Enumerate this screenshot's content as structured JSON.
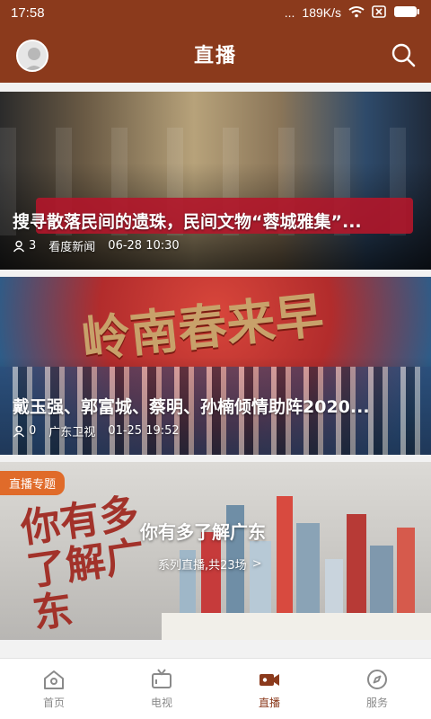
{
  "status_bar": {
    "time": "17:58",
    "more": "...",
    "network_speed": "189K/s"
  },
  "app_bar": {
    "title": "直播"
  },
  "feed": [
    {
      "title": "搜寻散落民间的遗珠，民间文物“蓉城雅集”...",
      "views": "3",
      "source": "看度新闻",
      "time": "06-28 10:30"
    },
    {
      "title": "戴玉强、郭富城、蔡明、孙楠倾情助阵2020...",
      "views": "0",
      "source": "广东卫视",
      "time": "01-25 19:52"
    }
  ],
  "special": {
    "badge": "直播专题",
    "title": "你有多了解广东",
    "subtitle": "系列直播,共23场",
    "poster_text": "你有多了解广东",
    "arrow": ">"
  },
  "tabs": [
    {
      "label": "首页",
      "icon": "home-icon"
    },
    {
      "label": "电视",
      "icon": "tv-icon"
    },
    {
      "label": "直播",
      "icon": "live-icon"
    },
    {
      "label": "服务",
      "icon": "compass-icon"
    }
  ],
  "colors": {
    "brand": "#8b3a1c",
    "badge": "#e06b2a",
    "tab_inactive": "#8a8a8a"
  }
}
